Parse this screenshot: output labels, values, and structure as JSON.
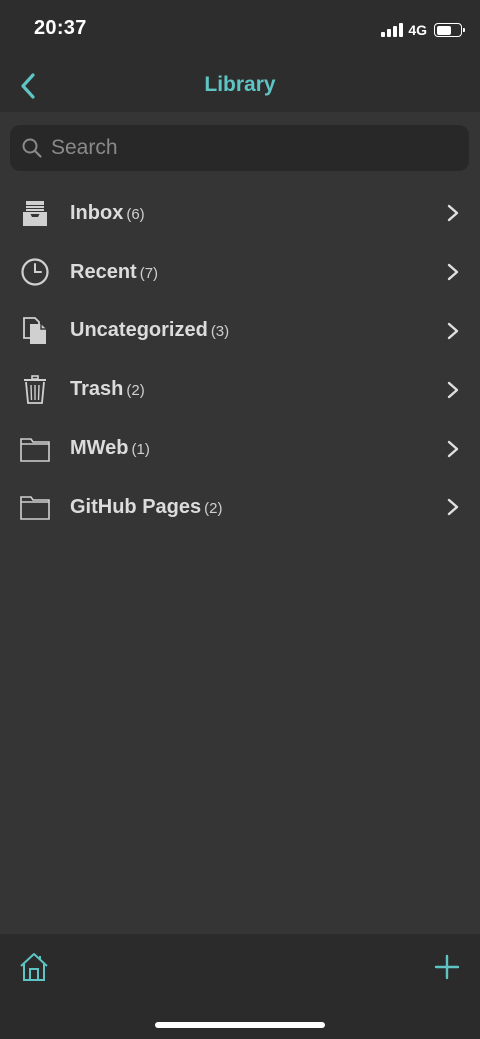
{
  "status_bar": {
    "time": "20:37",
    "network": "4G"
  },
  "nav": {
    "title": "Library"
  },
  "search": {
    "placeholder": "Search"
  },
  "library_items": [
    {
      "label": "Inbox",
      "count": "(6)",
      "icon": "inbox-tray-icon"
    },
    {
      "label": "Recent",
      "count": "(7)",
      "icon": "clock-icon"
    },
    {
      "label": "Uncategorized",
      "count": "(3)",
      "icon": "documents-icon"
    },
    {
      "label": "Trash",
      "count": "(2)",
      "icon": "trash-icon"
    },
    {
      "label": "MWeb",
      "count": "(1)",
      "icon": "folder-icon"
    },
    {
      "label": "GitHub Pages",
      "count": "(2)",
      "icon": "folder-icon"
    }
  ],
  "colors": {
    "accent": "#5fc4c4",
    "background": "#353535",
    "bars": "#2d2d2d"
  },
  "tab_bar": {
    "left_icon": "home-icon",
    "right_icon": "plus-icon"
  }
}
